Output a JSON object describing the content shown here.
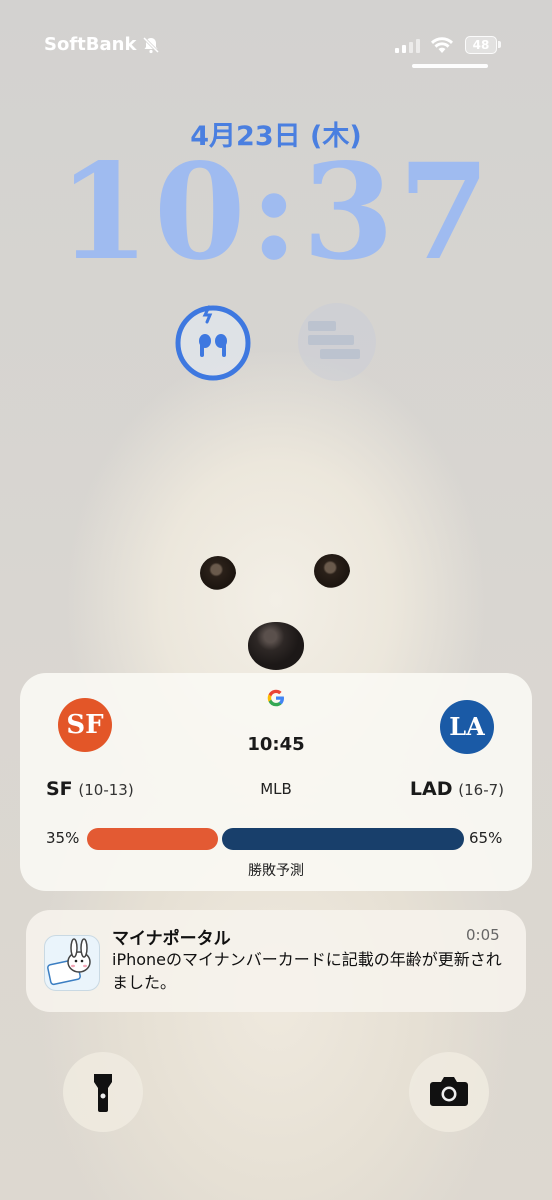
{
  "status_bar": {
    "carrier": "SoftBank",
    "battery_level": "48",
    "icons": [
      "bell-slash-icon",
      "signal-icon",
      "wifi-icon",
      "battery-icon"
    ]
  },
  "lock_screen": {
    "date": "4月23日 (木)",
    "time": "10:37",
    "accent_color": "#4a7fe0",
    "widgets": [
      "airpods-battery-icon",
      "placeholder-widget-icon"
    ]
  },
  "game_card": {
    "source_icon": "google-icon",
    "time": "10:45",
    "league": "MLB",
    "home": {
      "abbr": "SF",
      "record": "(10-13)",
      "logo_text": "SF",
      "color": "#e35628",
      "win_pct": "35%"
    },
    "away": {
      "abbr": "LAD",
      "record": "(16-7)",
      "logo_text": "LA",
      "color": "#1a5aa6",
      "win_pct": "65%"
    },
    "prediction_fraction": {
      "sf": 0.35,
      "lad": 0.65
    },
    "prediction_label": "勝敗予測"
  },
  "notification": {
    "app": "マイナポータル",
    "time": "0:05",
    "body": "iPhoneのマイナンバーカードに記載の年齢が更新されました。",
    "icon": "mynaportal-icon"
  },
  "controls": {
    "left": "flashlight-icon",
    "right": "camera-icon"
  }
}
